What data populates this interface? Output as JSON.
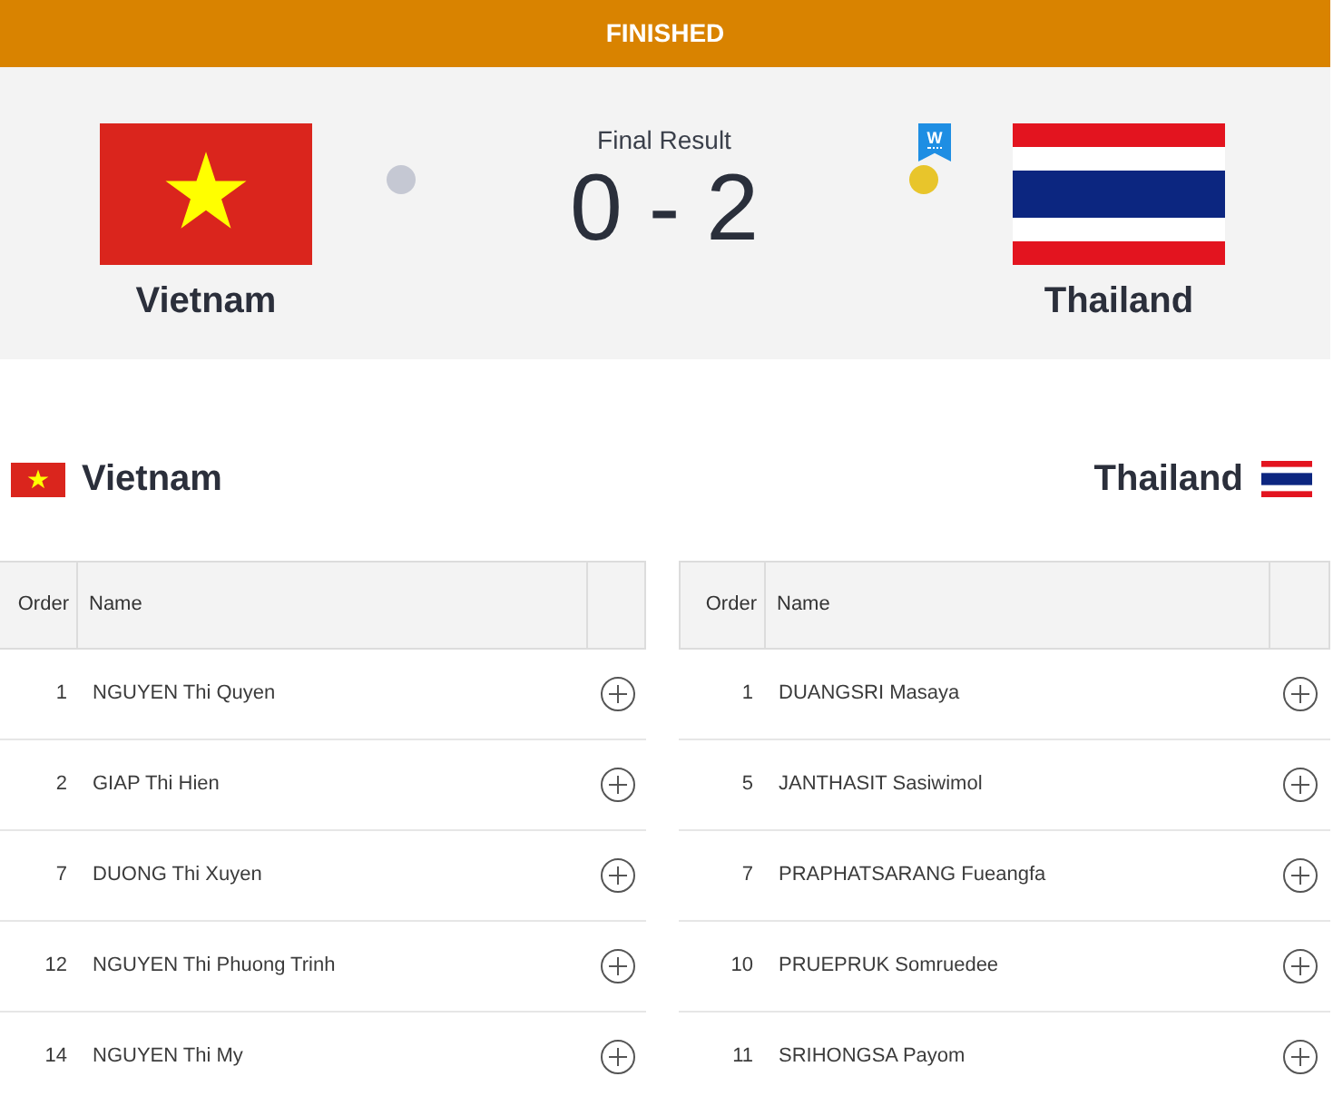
{
  "status": {
    "label": "FINISHED"
  },
  "match": {
    "result_label": "Final Result",
    "score": "0 - 2",
    "winner_badge": "W",
    "teams": [
      {
        "name": "Vietnam",
        "flag": {
          "kind": "star"
        },
        "winner": false
      },
      {
        "name": "Thailand",
        "flag": {
          "kind": "striped"
        },
        "winner": true
      }
    ]
  },
  "lineups": [
    {
      "team": "Vietnam",
      "flag": {
        "kind": "star"
      },
      "columns": [
        "Order",
        "Name"
      ],
      "rows": [
        {
          "order": "1",
          "name": "NGUYEN Thi Quyen"
        },
        {
          "order": "2",
          "name": "GIAP Thi Hien"
        },
        {
          "order": "7",
          "name": "DUONG Thi Xuyen"
        },
        {
          "order": "12",
          "name": "NGUYEN Thi Phuong Trinh"
        },
        {
          "order": "14",
          "name": "NGUYEN Thi My"
        }
      ]
    },
    {
      "team": "Thailand",
      "flag": {
        "kind": "striped"
      },
      "columns": [
        "Order",
        "Name"
      ],
      "rows": [
        {
          "order": "1",
          "name": "DUANGSRI Masaya"
        },
        {
          "order": "5",
          "name": "JANTHASIT Sasiwimol"
        },
        {
          "order": "7",
          "name": "PRAPHATSARANG Fueangfa"
        },
        {
          "order": "10",
          "name": "PRUEPRUK Somruedee"
        },
        {
          "order": "11",
          "name": "SRIHONGSA Payom"
        }
      ]
    }
  ]
}
